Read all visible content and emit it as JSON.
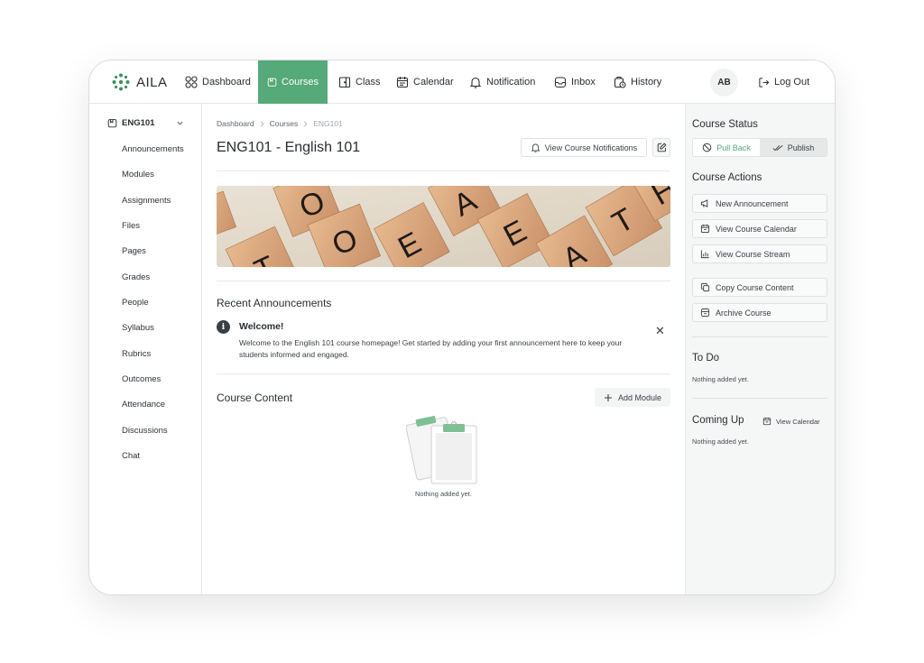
{
  "app": {
    "name": "AILA",
    "avatar_initials": "AB",
    "logout_label": "Log Out",
    "accent_color": "#56a979"
  },
  "nav": {
    "items": [
      {
        "label": "Dashboard",
        "icon": "grid-circles-icon"
      },
      {
        "label": "Courses",
        "icon": "course-book-icon",
        "active": true
      },
      {
        "label": "Class",
        "icon": "class-door-icon"
      },
      {
        "label": "Calendar",
        "icon": "calendar-icon"
      },
      {
        "label": "Notification",
        "icon": "bell-icon"
      },
      {
        "label": "Inbox",
        "icon": "inbox-tray-icon"
      },
      {
        "label": "History",
        "icon": "history-clock-icon"
      }
    ]
  },
  "sidebar": {
    "course_code": "ENG101",
    "items": [
      "Announcements",
      "Modules",
      "Assignments",
      "Files",
      "Pages",
      "Grades",
      "People",
      "Syllabus",
      "Rubrics",
      "Outcomes",
      "Attendance",
      "Discussions",
      "Chat"
    ]
  },
  "main": {
    "breadcrumb": [
      "Dashboard",
      "Courses",
      "ENG101"
    ],
    "title": "ENG101 - English 101",
    "view_notifications_label": "View Course Notifications",
    "recent_announcements_title": "Recent Announcements",
    "announcement": {
      "title": "Welcome!",
      "body": "Welcome to the English 101 course homepage! Get started by adding your first announcement here to keep your students informed and engaged."
    },
    "course_content_title": "Course Content",
    "add_module_label": "Add Module",
    "empty_text": "Nothing added yet."
  },
  "right_panel": {
    "course_status_title": "Course Status",
    "pull_back_label": "Pull Back",
    "publish_label": "Publish",
    "course_actions_title": "Course Actions",
    "actions": [
      "New Announcement",
      "View Course Calendar",
      "View Course Stream",
      "Copy Course Content",
      "Archive Course"
    ],
    "todo_title": "To Do",
    "todo_empty": "Nothing added yet.",
    "coming_up_title": "Coming Up",
    "view_calendar_label": "View Calendar",
    "coming_up_empty": "Nothing added yet."
  }
}
